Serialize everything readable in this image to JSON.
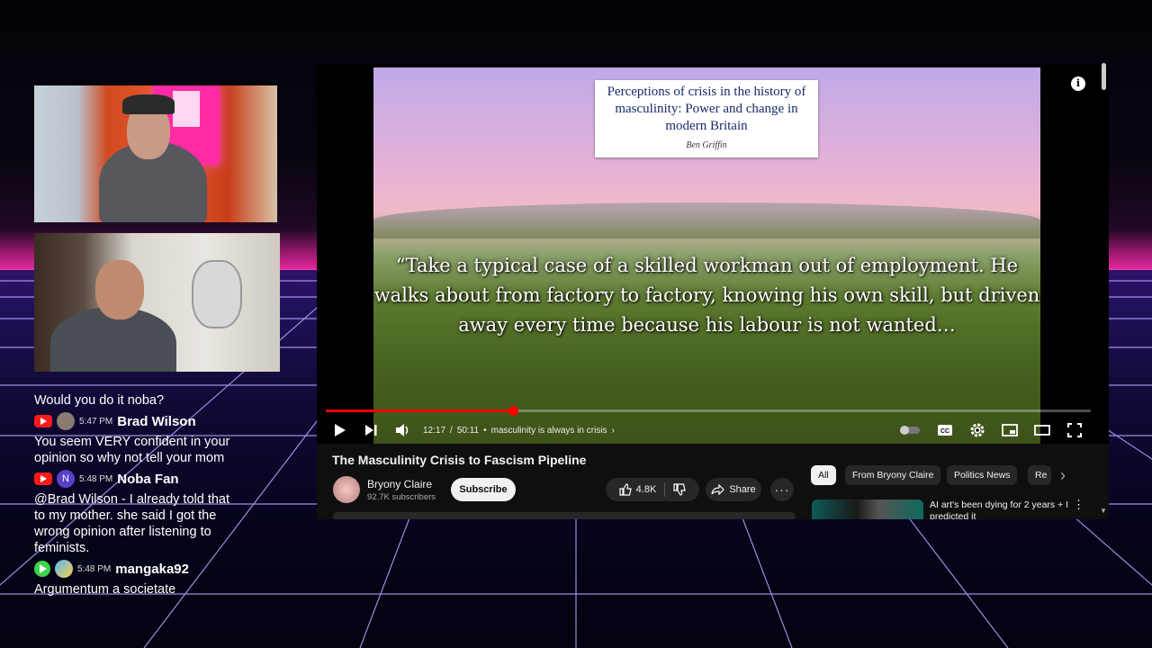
{
  "chat": [
    {
      "type": "text",
      "text": "Would you do it noba?"
    },
    {
      "type": "meta",
      "platform": "youtube",
      "avatar": "",
      "time": "5:47 PM",
      "name": "Brad Wilson"
    },
    {
      "type": "text",
      "text": "You seem VERY confident in your opinion so why not tell your mom"
    },
    {
      "type": "meta",
      "platform": "youtube",
      "avatar": "N",
      "time": "5:48 PM",
      "name": "Noba Fan"
    },
    {
      "type": "text",
      "text": "@Brad Wilson - I already told that to my mother. she said I got the wrong opinion after listening to feminists."
    },
    {
      "type": "meta",
      "platform": "rumble",
      "avatar": "",
      "time": "5:48 PM",
      "name": "mangaka92"
    },
    {
      "type": "text",
      "text": "Argumentum a societate"
    }
  ],
  "video": {
    "book_title": "Perceptions of crisis in the history of masculinity: Power and change in modern Britain",
    "book_author": "Ben Griffin",
    "quote": "“Take a typical case of a skilled workman out of employment. He walks about from factory to factory, knowing his own skill, but driven away every time because his labour is not wanted…",
    "time_current": "12:17",
    "time_separator": "/",
    "time_total": "50:11",
    "chapter": "masculinity is always in crisis",
    "progress": 0.245
  },
  "page": {
    "title": "The Masculinity Crisis to Fascism Pipeline",
    "channel": "Bryony Claire",
    "subscribers": "92.7K subscribers",
    "subscribe_label": "Subscribe",
    "likes": "4.8K",
    "share_label": "Share"
  },
  "chips": [
    "All",
    "From Bryony Claire",
    "Politics News",
    "Re"
  ],
  "recommendation": {
    "title": "AI art's been dying for 2 years + I predicted it"
  },
  "colors": {
    "accent": "#ff0000",
    "neon": "#ff2aa4",
    "yt_bg": "#0f0f0f"
  }
}
